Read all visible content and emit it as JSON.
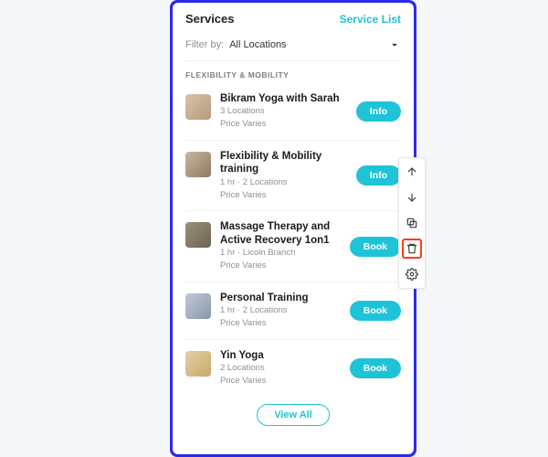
{
  "header": {
    "title": "Services",
    "link": "Service List"
  },
  "filter": {
    "label": "Filter by:",
    "value": "All Locations"
  },
  "section": {
    "label": "FLEXIBILITY & MOBILITY"
  },
  "items": [
    {
      "title": "Bikram Yoga with Sarah",
      "meta1": "3 Locations",
      "meta2": "Price Varies",
      "action": "Info"
    },
    {
      "title": "Flexibility & Mobility training",
      "meta1": "1 hr · 2 Locations",
      "meta2": "Price Varies",
      "action": "Info"
    },
    {
      "title": "Massage Therapy and Active Recovery 1on1",
      "meta1": "1 hr · Licoln Branch",
      "meta2": "Price Varies",
      "action": "Book"
    },
    {
      "title": "Personal Training",
      "meta1": "1 hr · 2 Locations",
      "meta2": "Price Varies",
      "action": "Book"
    },
    {
      "title": "Yin Yoga",
      "meta1": "2 Locations",
      "meta2": "Price Varies",
      "action": "Book"
    }
  ],
  "viewAll": "View All",
  "tools": {
    "up": "move-up",
    "down": "move-down",
    "copy": "duplicate",
    "delete": "delete",
    "settings": "settings"
  }
}
